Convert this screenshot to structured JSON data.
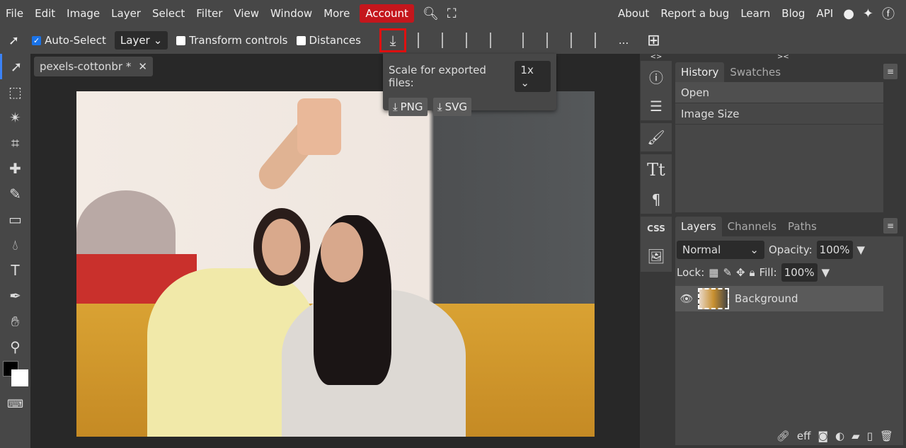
{
  "menu": {
    "items": [
      "File",
      "Edit",
      "Image",
      "Layer",
      "Select",
      "Filter",
      "View",
      "Window",
      "More"
    ],
    "account": "Account",
    "right": [
      "About",
      "Report a bug",
      "Learn",
      "Blog",
      "API"
    ]
  },
  "toolbar": {
    "auto_select": "Auto-Select",
    "layer_select": "Layer",
    "transform": "Transform controls",
    "distances": "Distances",
    "more": "..."
  },
  "export_popup": {
    "scale_label": "Scale for exported files:",
    "scale_value": "1x",
    "png": "PNG",
    "svg": "SVG"
  },
  "document": {
    "tab_name": "pexels-cottonbr",
    "modified": "*",
    "close": "✕"
  },
  "history": {
    "tabs": [
      "History",
      "Swatches"
    ],
    "items": [
      "Open",
      "Image Size"
    ]
  },
  "layers": {
    "tabs": [
      "Layers",
      "Channels",
      "Paths"
    ],
    "blend_mode": "Normal",
    "opacity_label": "Opacity:",
    "opacity": "100%",
    "lock_label": "Lock:",
    "fill_label": "Fill:",
    "fill": "100%",
    "items": [
      {
        "name": "Background"
      }
    ]
  },
  "icons": {
    "css": "CSS",
    "collapse_left": "<>",
    "collapse_right": "><"
  },
  "footer": {
    "eff": "eff"
  }
}
